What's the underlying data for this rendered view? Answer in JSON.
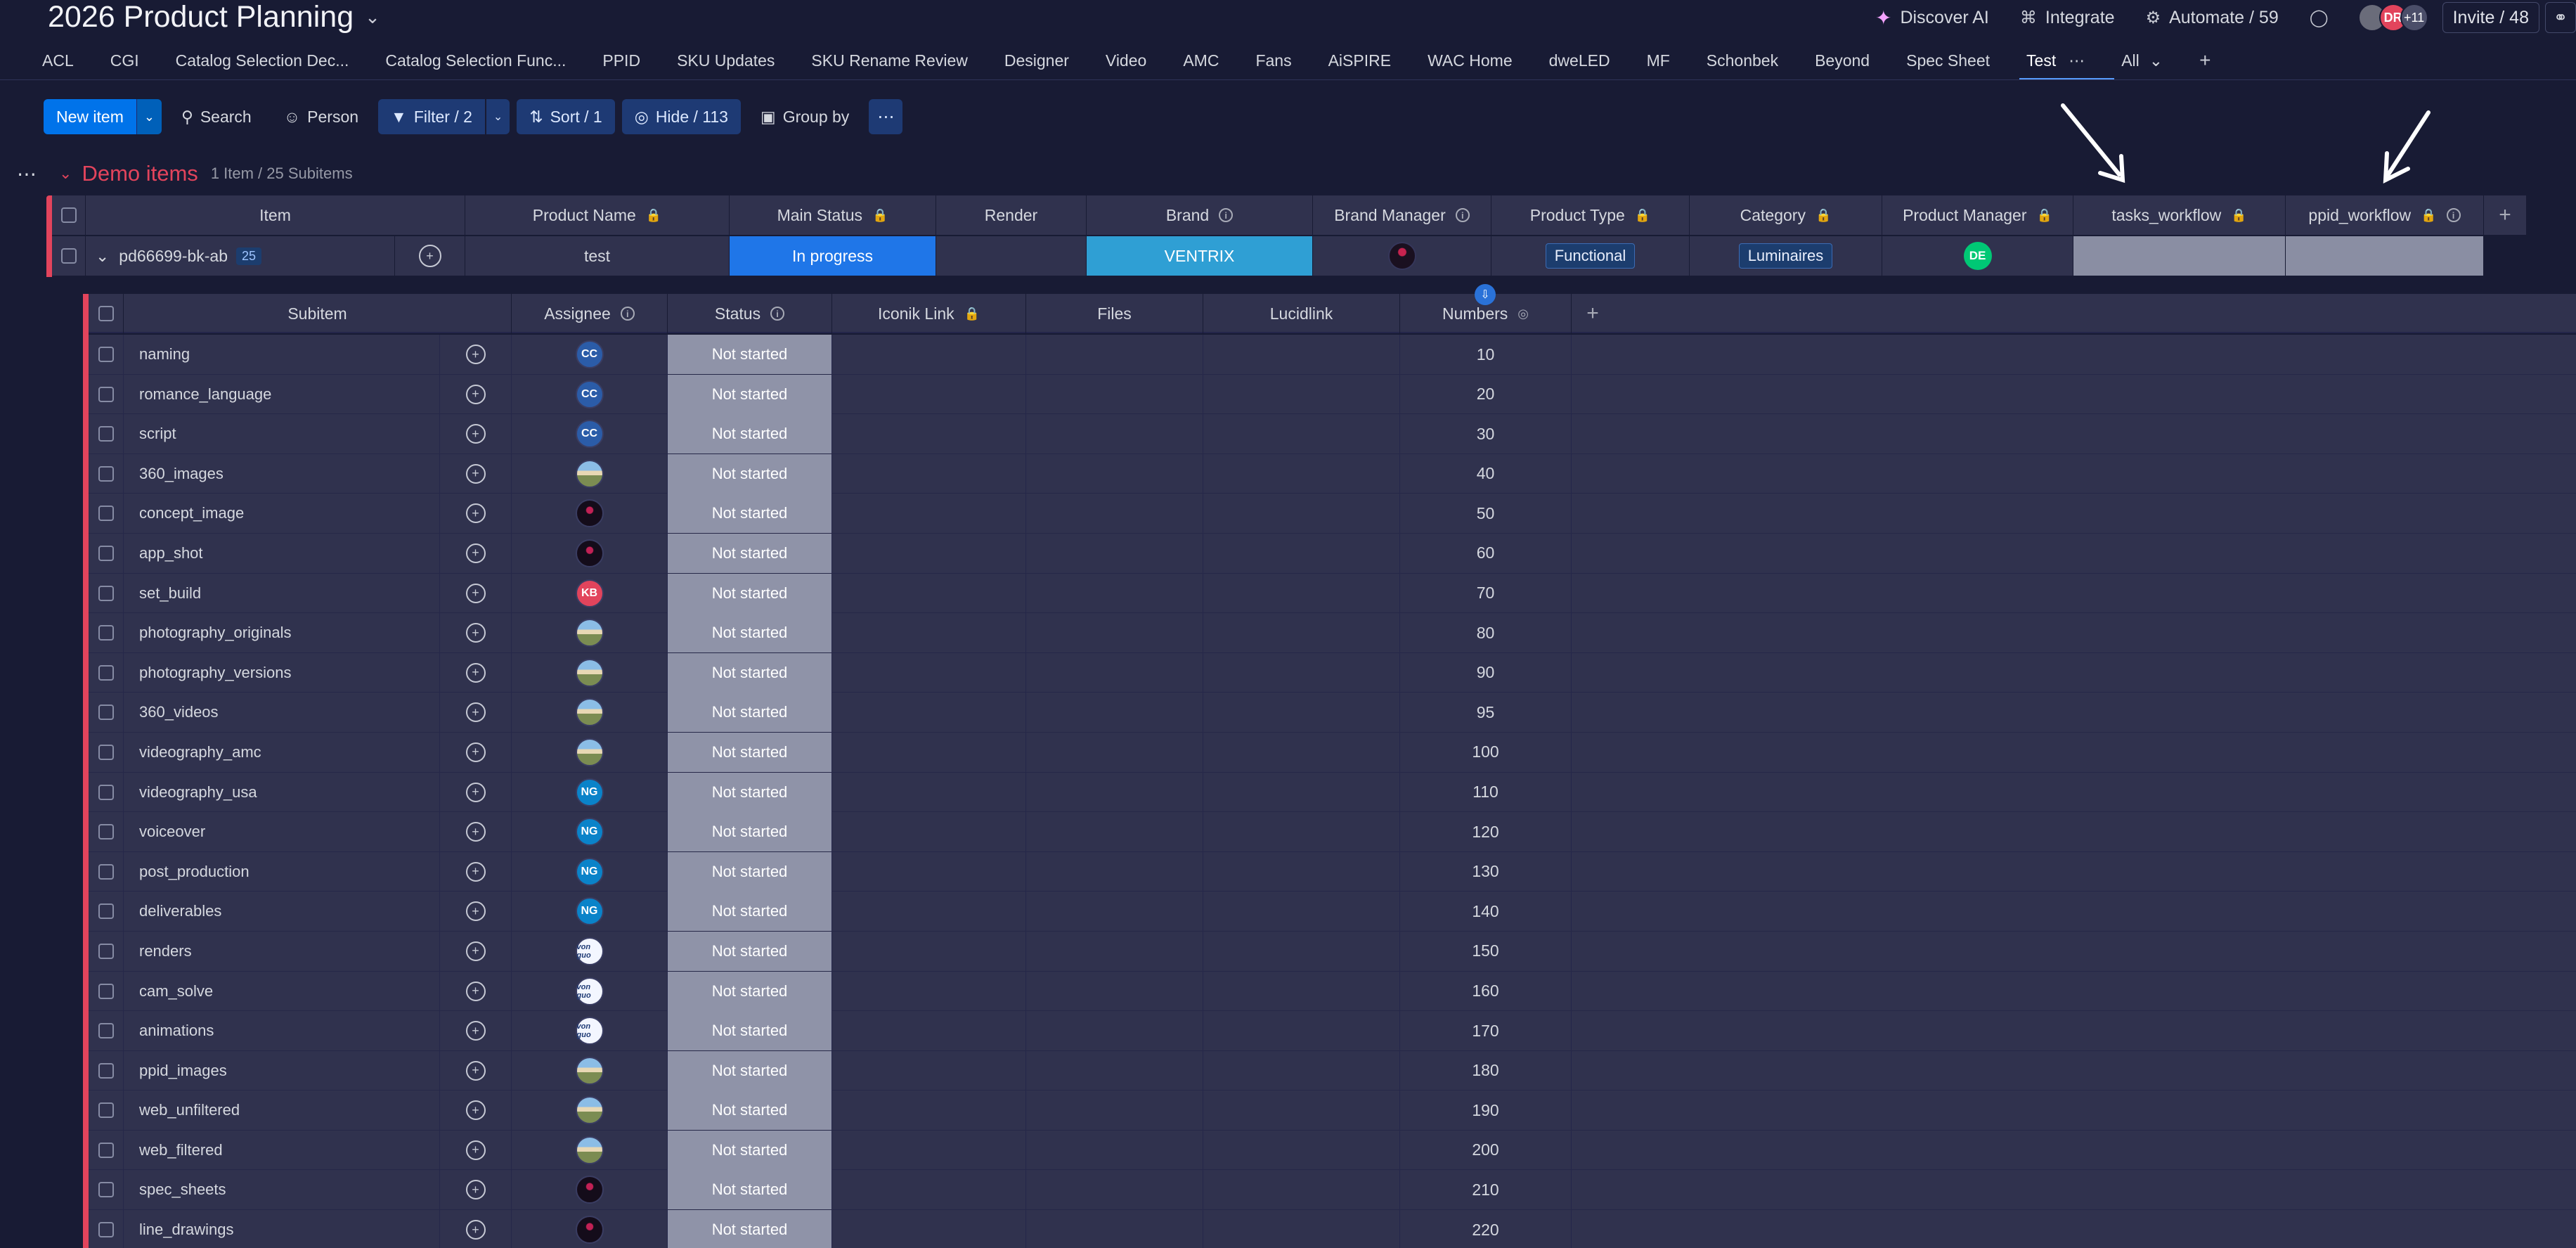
{
  "header": {
    "title": "2026 Product Planning",
    "discover_ai": "Discover AI",
    "integrate": "Integrate",
    "automate": "Automate / 59",
    "avatar_dr": "DR",
    "more_people": "+11",
    "invite": "Invite / 48"
  },
  "tabs": [
    "ACL",
    "CGI",
    "Catalog Selection Dec...",
    "Catalog Selection Func...",
    "PPID",
    "SKU Updates",
    "SKU Rename Review",
    "Designer",
    "Video",
    "AMC",
    "Fans",
    "AiSPIRE",
    "WAC Home",
    "dweLED",
    "MF",
    "Schonbek",
    "Beyond",
    "Spec Sheet",
    "Test"
  ],
  "tab_all": "All",
  "toolbar": {
    "new_item": "New item",
    "search": "Search",
    "person": "Person",
    "filter": "Filter / 2",
    "sort": "Sort / 1",
    "hide": "Hide / 113",
    "group_by": "Group by"
  },
  "group": {
    "name": "Demo items",
    "count": "1 Item / 25 Subitems"
  },
  "main_columns": {
    "item": "Item",
    "product_name": "Product Name",
    "main_status": "Main Status",
    "render": "Render",
    "brand": "Brand",
    "brand_manager": "Brand Manager",
    "product_type": "Product Type",
    "category": "Category",
    "product_manager": "Product Manager",
    "tasks_workflow": "tasks_workflow",
    "ppid_workflow": "ppid_workflow"
  },
  "main_item": {
    "name": "pd66699-bk-ab",
    "subitem_count": "25",
    "product_name": "test",
    "main_status": "In progress",
    "main_status_color": "#1f76e8",
    "brand": "VENTRIX",
    "brand_color": "#2f9fd4",
    "product_type": "Functional",
    "category": "Luminaires",
    "product_manager_initials": "DE"
  },
  "sub_columns": {
    "subitem": "Subitem",
    "assignee": "Assignee",
    "status": "Status",
    "iconik_link": "Iconik Link",
    "files": "Files",
    "lucidlink": "Lucidlink",
    "numbers": "Numbers"
  },
  "subitems": [
    {
      "name": "naming",
      "assignee": "CC",
      "type": "cc",
      "status": "Not started",
      "number": "10"
    },
    {
      "name": "romance_language",
      "assignee": "CC",
      "type": "cc",
      "status": "Not started",
      "number": "20"
    },
    {
      "name": "script",
      "assignee": "CC",
      "type": "cc",
      "status": "Not started",
      "number": "30"
    },
    {
      "name": "360_images",
      "assignee": "",
      "type": "photo",
      "status": "Not started",
      "number": "40"
    },
    {
      "name": "concept_image",
      "assignee": "",
      "type": "dark",
      "status": "Not started",
      "number": "50"
    },
    {
      "name": "app_shot",
      "assignee": "",
      "type": "dark",
      "status": "Not started",
      "number": "60"
    },
    {
      "name": "set_build",
      "assignee": "KB",
      "type": "kb",
      "status": "Not started",
      "number": "70"
    },
    {
      "name": "photography_originals",
      "assignee": "",
      "type": "photo",
      "status": "Not started",
      "number": "80"
    },
    {
      "name": "photography_versions",
      "assignee": "",
      "type": "photo",
      "status": "Not started",
      "number": "90"
    },
    {
      "name": "360_videos",
      "assignee": "",
      "type": "photo",
      "status": "Not started",
      "number": "95"
    },
    {
      "name": "videography_amc",
      "assignee": "",
      "type": "photo",
      "status": "Not started",
      "number": "100"
    },
    {
      "name": "videography_usa",
      "assignee": "NG",
      "type": "ng",
      "status": "Not started",
      "number": "110"
    },
    {
      "name": "voiceover",
      "assignee": "NG",
      "type": "ng",
      "status": "Not started",
      "number": "120"
    },
    {
      "name": "post_production",
      "assignee": "NG",
      "type": "ng",
      "status": "Not started",
      "number": "130"
    },
    {
      "name": "deliverables",
      "assignee": "NG",
      "type": "ng",
      "status": "Not started",
      "number": "140"
    },
    {
      "name": "renders",
      "assignee": "von guo",
      "type": "logo",
      "status": "Not started",
      "number": "150"
    },
    {
      "name": "cam_solve",
      "assignee": "von guo",
      "type": "logo",
      "status": "Not started",
      "number": "160"
    },
    {
      "name": "animations",
      "assignee": "von guo",
      "type": "logo",
      "status": "Not started",
      "number": "170"
    },
    {
      "name": "ppid_images",
      "assignee": "",
      "type": "photo",
      "status": "Not started",
      "number": "180"
    },
    {
      "name": "web_unfiltered",
      "assignee": "",
      "type": "photo",
      "status": "Not started",
      "number": "190"
    },
    {
      "name": "web_filtered",
      "assignee": "",
      "type": "photo",
      "status": "Not started",
      "number": "200"
    },
    {
      "name": "spec_sheets",
      "assignee": "",
      "type": "dark",
      "status": "Not started",
      "number": "210"
    },
    {
      "name": "line_drawings",
      "assignee": "",
      "type": "dark",
      "status": "Not started",
      "number": "220"
    }
  ],
  "colors": {
    "background": "#181b34",
    "group_accent": "#e2445c",
    "primary": "#0073ea",
    "not_started": "#8f93a8"
  }
}
